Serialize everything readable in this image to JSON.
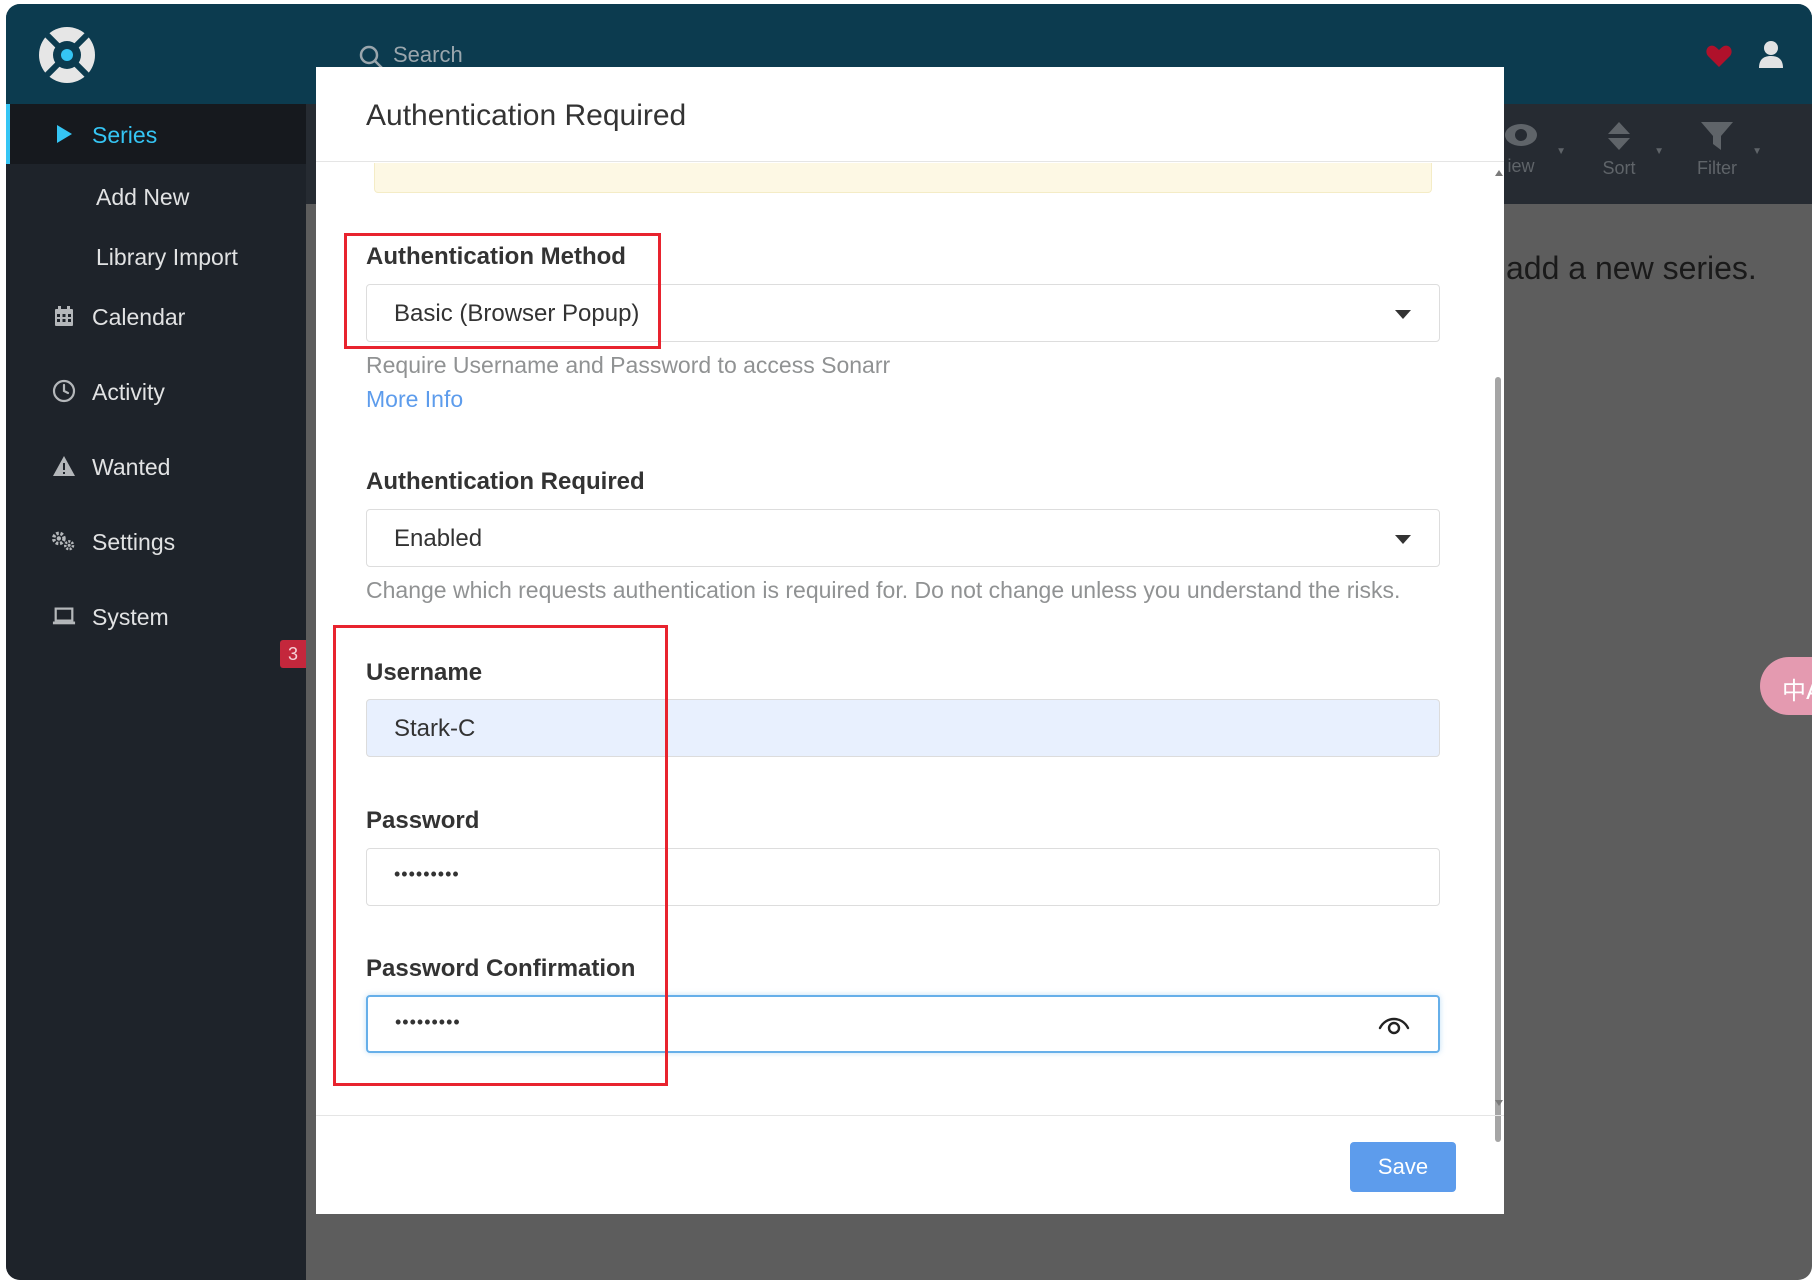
{
  "header": {
    "search_placeholder": "Search"
  },
  "sidebar": {
    "items": [
      {
        "label": "Series",
        "icon": "play-icon",
        "active": true
      },
      {
        "label": "Add New",
        "icon": null
      },
      {
        "label": "Library Import",
        "icon": null
      },
      {
        "label": "Calendar",
        "icon": "calendar-icon"
      },
      {
        "label": "Activity",
        "icon": "clock-icon"
      },
      {
        "label": "Wanted",
        "icon": "warning-icon"
      },
      {
        "label": "Settings",
        "icon": "gears-icon"
      },
      {
        "label": "System",
        "icon": "laptop-icon",
        "badge": "3"
      }
    ]
  },
  "toolbar": {
    "view_label": "iew",
    "sort_label": "Sort",
    "filter_label": "Filter"
  },
  "page": {
    "message": "add a new series."
  },
  "translate_button": {
    "glyph": "中A"
  },
  "modal": {
    "title": "Authentication Required",
    "auth_method": {
      "label": "Authentication Method",
      "value": "Basic (Browser Popup)",
      "help": "Require Username and Password to access Sonarr",
      "link": "More Info"
    },
    "auth_required": {
      "label": "Authentication Required",
      "value": "Enabled",
      "help": "Change which requests authentication is required for. Do not change unless you understand the risks."
    },
    "username": {
      "label": "Username",
      "value": "Stark-C"
    },
    "password": {
      "label": "Password",
      "masked": "•••••••••"
    },
    "password_confirmation": {
      "label": "Password Confirmation",
      "masked": "•••••••••"
    },
    "save_label": "Save"
  },
  "colors": {
    "header": "#0c3b4f",
    "sidebar": "#1e232a",
    "accent": "#35c5f4",
    "primary_button": "#5d9cec",
    "highlight_box": "#e8232e",
    "badge": "#c4273c"
  }
}
